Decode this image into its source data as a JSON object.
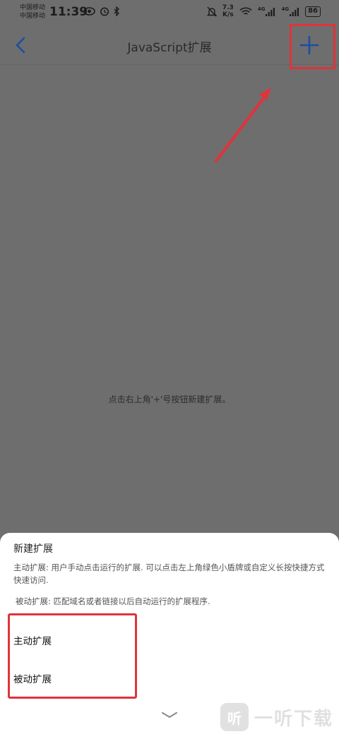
{
  "status_bar": {
    "carrier_1": "中国移动",
    "carrier_2": "中国移动",
    "time": "11:39",
    "net_speed_value": "7.3",
    "net_speed_unit": "K/s",
    "signal_1": "4G",
    "signal_2": "4G",
    "battery": "86"
  },
  "navbar": {
    "title": "JavaScript扩展"
  },
  "main": {
    "empty_hint": "点击右上角'+'号按钮新建扩展。"
  },
  "sheet": {
    "title": "新建扩展",
    "desc_active": "主动扩展: 用户手动点击运行的扩展. 可以点击左上角绿色小盾牌或自定义长按快捷方式快速访问.",
    "desc_passive": "被动扩展: 匹配域名或者链接以后自动运行的扩展程序.",
    "option_active": "主动扩展",
    "option_passive": "被动扩展"
  },
  "watermark": {
    "logo_char": "听",
    "text": "一听下载"
  },
  "colors": {
    "overlay": "#6e6e6e",
    "accent_blue": "#1a4fa0",
    "highlight_red": "#e0333b"
  }
}
